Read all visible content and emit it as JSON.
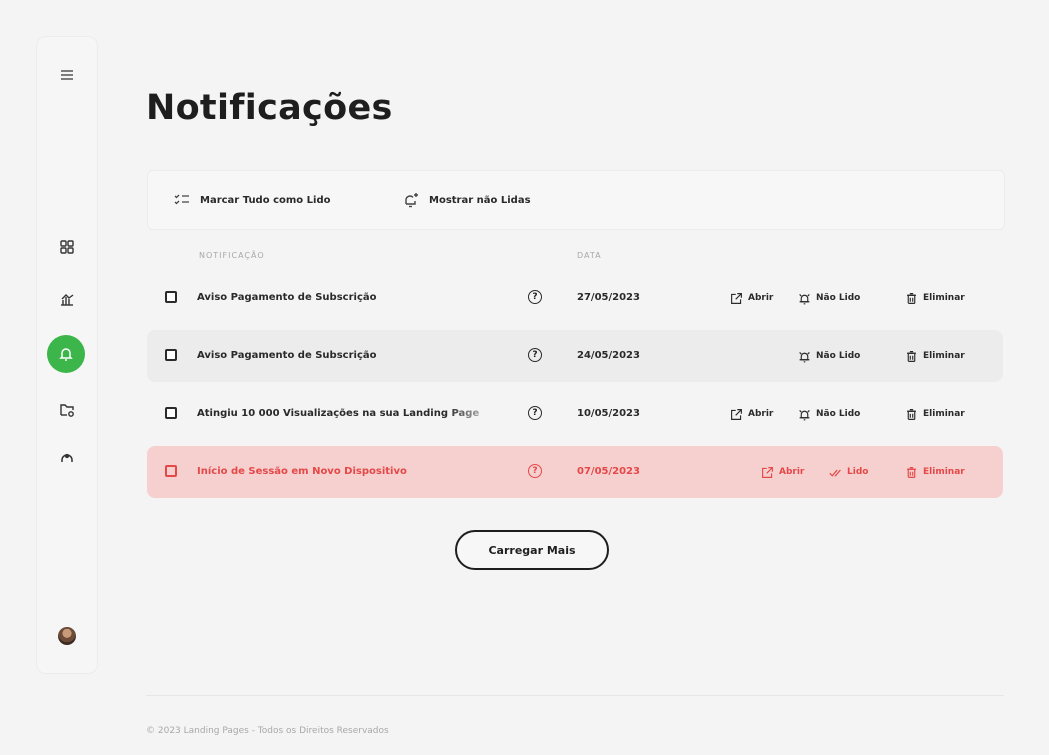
{
  "page": {
    "title": "Notificações"
  },
  "toolbar": {
    "mark_all_label": "Marcar Tudo como Lido",
    "show_unread_label": "Mostrar não Lidas"
  },
  "table": {
    "headers": {
      "notification": "NOTIFICAÇÃO",
      "date": "DATA"
    },
    "rows": [
      {
        "text": "Aviso Pagamento de Subscrição",
        "date": "27/05/2023",
        "actions": [
          "Abrir",
          "Não Lido",
          "Eliminar"
        ]
      },
      {
        "text": "Aviso Pagamento de Subscrição",
        "date": "24/05/2023",
        "actions": [
          "Não Lido",
          "Eliminar"
        ]
      },
      {
        "text": "Atingiu 10 000 Visualizações na sua Landing Page",
        "date": "10/05/2023",
        "actions": [
          "Abrir",
          "Não Lido",
          "Eliminar"
        ]
      },
      {
        "text": "Início de Sessão em Novo Dispositivo",
        "date": "07/05/2023",
        "actions": [
          "Abrir",
          "Lido",
          "Eliminar"
        ]
      }
    ]
  },
  "load_more_label": "Carregar Mais",
  "footer": {
    "text": "© 2023 Landing Pages - Todos os Direitos Reservados"
  },
  "colors": {
    "accent": "#3cb54a",
    "alert": "#e54848",
    "alert_bg": "#f6cfcf"
  },
  "sidebar": {
    "icons": [
      "menu-icon",
      "dashboard-icon",
      "analytics-icon",
      "bell-icon",
      "folder-settings-icon",
      "support-icon",
      "avatar"
    ]
  }
}
